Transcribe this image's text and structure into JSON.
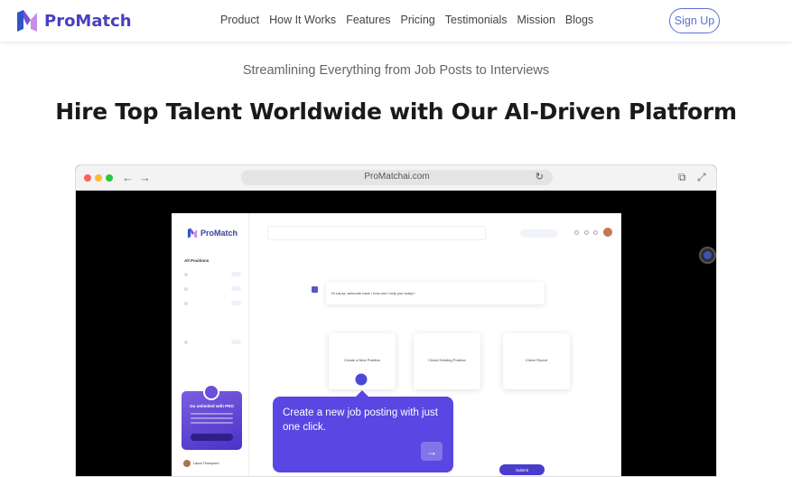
{
  "header": {
    "brand": "ProMatch",
    "nav": [
      "Product",
      "How It Works",
      "Features",
      "Pricing",
      "Testimonials",
      "Mission",
      "Blogs"
    ],
    "signup": "Sign Up"
  },
  "hero": {
    "tagline": "Streamlining Everything from Job Posts to Interviews",
    "headline": "Hire Top Talent Worldwide with Our AI-Driven Platform"
  },
  "browser": {
    "url": "ProMatchai.com",
    "colors": {
      "close": "#ff5f57",
      "minimize": "#febc2e",
      "maximize": "#28c840"
    }
  },
  "app": {
    "brand": "ProMatch",
    "sidebar_heading": "All Positions",
    "greeting": "Hi Laura, welcome back ! how can I help you today?",
    "cards": [
      "Create a New Position",
      "Check Existing Position",
      "Check Report"
    ],
    "submit": "Submit",
    "pro_title": "Go unlimited with PRO",
    "user_name": "Laura Thompson"
  },
  "tooltip": {
    "text": "Create a new job posting with just one click.",
    "next_icon": "arrow-right-icon"
  },
  "accent": "#5847e2"
}
